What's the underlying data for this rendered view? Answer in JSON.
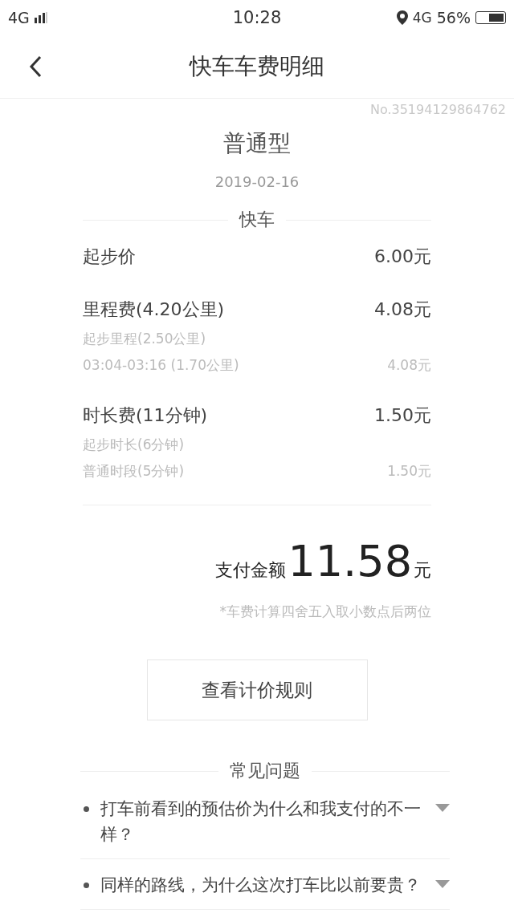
{
  "status_bar": {
    "network": "4G",
    "time": "10:28",
    "data": "4G",
    "battery": "56%"
  },
  "header": {
    "title": "快车车费明细"
  },
  "order_no": "No.35194129864762",
  "car_type": "普通型",
  "date": "2019-02-16",
  "section": "快车",
  "fees": [
    {
      "name": "起步价",
      "amount": "6.00元"
    },
    {
      "name": "里程费(4.20公里)",
      "amount": "4.08元",
      "details": [
        {
          "label": "起步里程(2.50公里)"
        },
        {
          "label": "03:04-03:16 (1.70公里)",
          "amount": "4.08元"
        }
      ]
    },
    {
      "name": "时长费(11分钟)",
      "amount": "1.50元",
      "details": [
        {
          "label": "起步时长(6分钟)"
        },
        {
          "label": "普通时段(5分钟)",
          "amount": "1.50元"
        }
      ]
    }
  ],
  "total": {
    "label": "支付金额",
    "amount": "11.58",
    "unit": "元"
  },
  "note": "*车费计算四舍五入取小数点后两位",
  "rules_button": "查看计价规则",
  "faq": {
    "title": "常见问题",
    "items": [
      {
        "question": "打车前看到的预估价为什么和我支付的不一样？",
        "expanded": false
      },
      {
        "question": "同样的路线，为什么这次打车比以前要贵？",
        "expanded": false
      }
    ]
  }
}
